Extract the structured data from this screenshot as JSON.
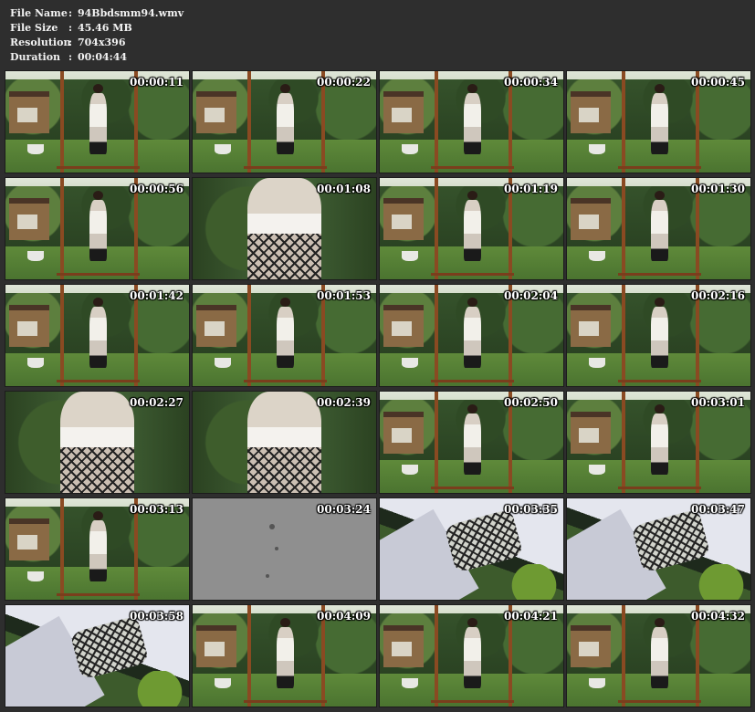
{
  "file_info": [
    {
      "key": "File Name",
      "value": "94Bbdsmm94.wmv"
    },
    {
      "key": "File Size",
      "value": "45.46 MB"
    },
    {
      "key": "Resolution",
      "value": "704x396"
    },
    {
      "key": "Duration",
      "value": "00:04:44"
    }
  ],
  "thumbnails": [
    {
      "timestamp": "00:00:11",
      "scene": "garden"
    },
    {
      "timestamp": "00:00:22",
      "scene": "garden"
    },
    {
      "timestamp": "00:00:34",
      "scene": "garden"
    },
    {
      "timestamp": "00:00:45",
      "scene": "garden"
    },
    {
      "timestamp": "00:00:56",
      "scene": "garden"
    },
    {
      "timestamp": "00:01:08",
      "scene": "closeup"
    },
    {
      "timestamp": "00:01:19",
      "scene": "garden"
    },
    {
      "timestamp": "00:01:30",
      "scene": "garden"
    },
    {
      "timestamp": "00:01:42",
      "scene": "garden"
    },
    {
      "timestamp": "00:01:53",
      "scene": "garden"
    },
    {
      "timestamp": "00:02:04",
      "scene": "garden"
    },
    {
      "timestamp": "00:02:16",
      "scene": "garden"
    },
    {
      "timestamp": "00:02:27",
      "scene": "closeup"
    },
    {
      "timestamp": "00:02:39",
      "scene": "closeup"
    },
    {
      "timestamp": "00:02:50",
      "scene": "garden"
    },
    {
      "timestamp": "00:03:01",
      "scene": "garden"
    },
    {
      "timestamp": "00:03:13",
      "scene": "garden"
    },
    {
      "timestamp": "00:03:24",
      "scene": "grey"
    },
    {
      "timestamp": "00:03:35",
      "scene": "tilt"
    },
    {
      "timestamp": "00:03:47",
      "scene": "tilt"
    },
    {
      "timestamp": "00:03:58",
      "scene": "tilt"
    },
    {
      "timestamp": "00:04:09",
      "scene": "garden"
    },
    {
      "timestamp": "00:04:21",
      "scene": "garden"
    },
    {
      "timestamp": "00:04:32",
      "scene": "garden"
    }
  ]
}
